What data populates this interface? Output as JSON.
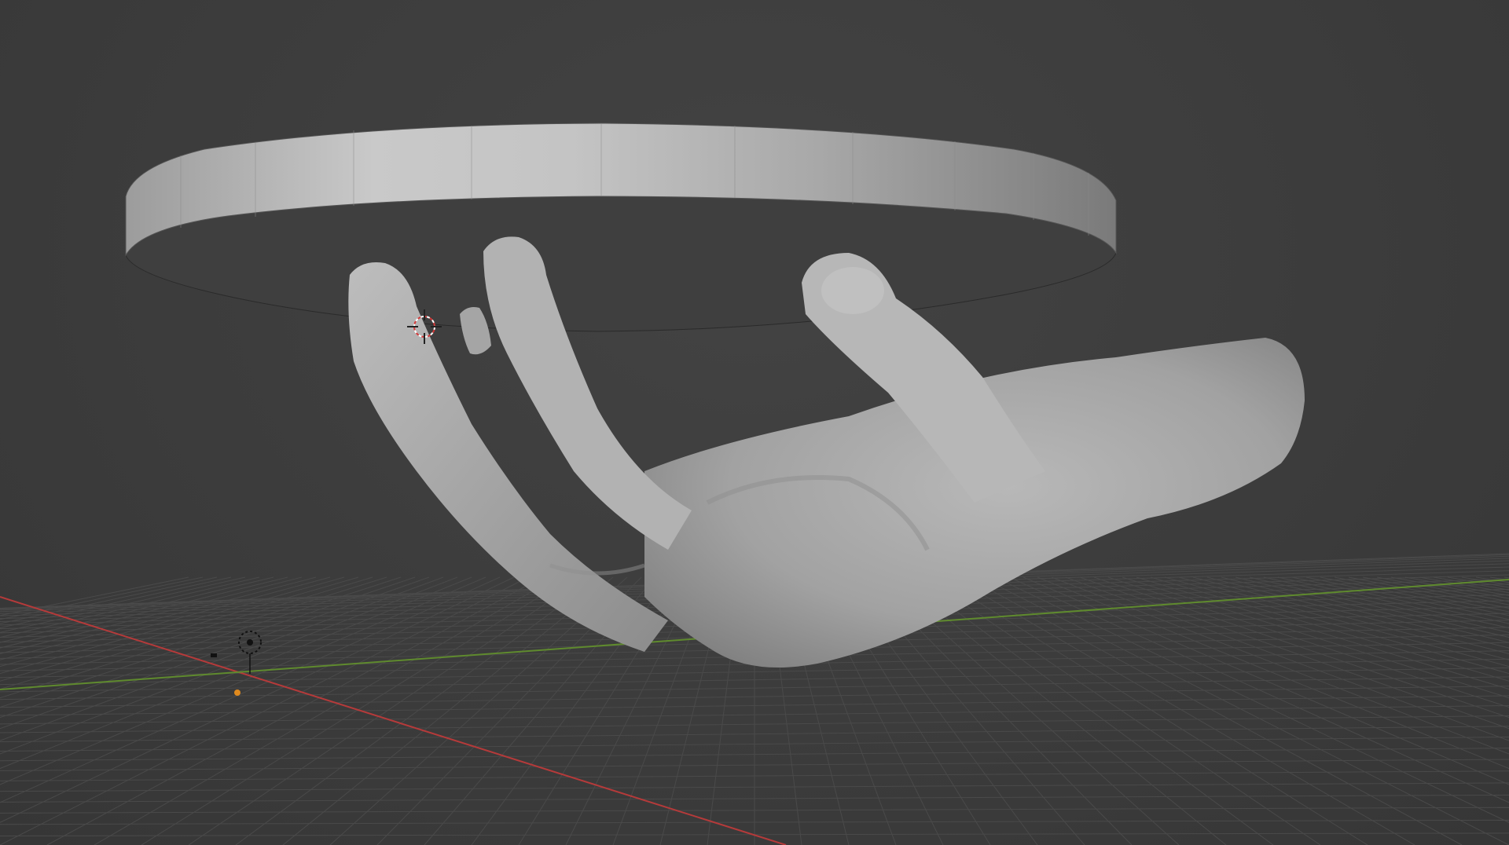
{
  "viewport": {
    "background_color": "#3d3d3d",
    "grid_color": "#4a4a4a",
    "x_axis_color": "#b53a3a",
    "y_axis_color": "#5f8a2e",
    "selection_color": "#e08a1e",
    "objects": [
      "disc-mesh",
      "hand-sculpt-mesh",
      "light-object",
      "camera-object",
      "origin-point"
    ]
  },
  "icons": {
    "cursor": "3d-cursor-icon",
    "light": "light-icon",
    "camera": "camera-icon",
    "origin": "origin-dot-icon"
  }
}
